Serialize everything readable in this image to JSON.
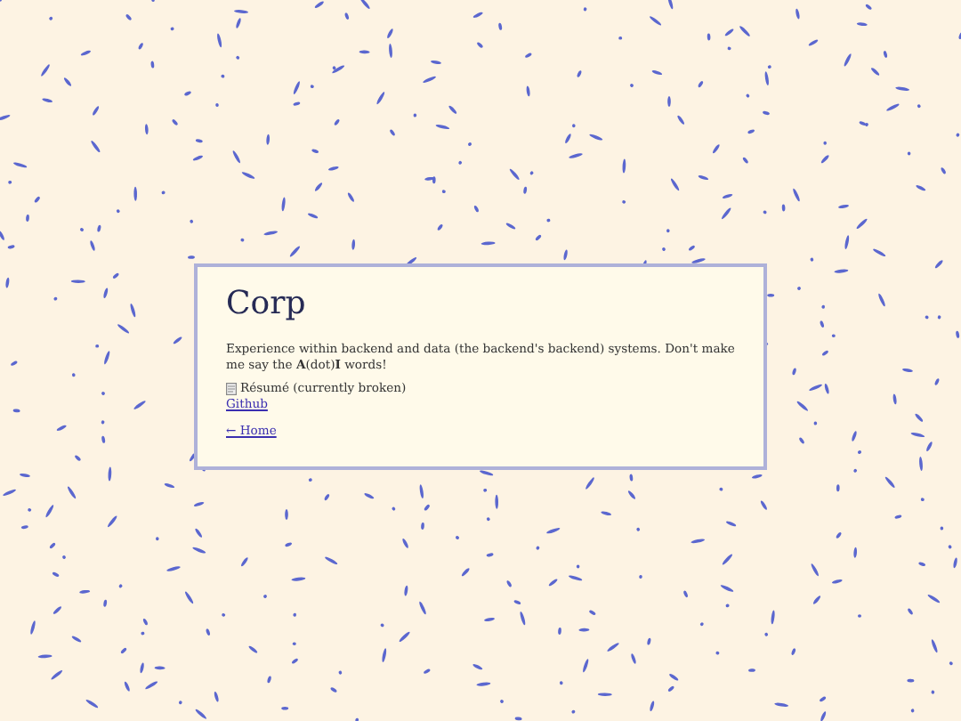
{
  "card": {
    "title": "Corp",
    "description": "Experience within backend and data (the backend's backend) systems. Don't make me say the **A**(dot)**I** words!",
    "resume": {
      "label": "Résumé (currently broken)"
    },
    "links": [
      {
        "label": "Github"
      }
    ],
    "home_link": "← Home"
  }
}
